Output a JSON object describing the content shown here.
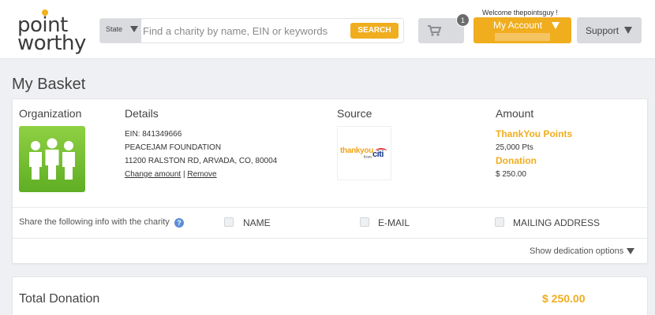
{
  "header": {
    "logo_line1": "point",
    "logo_line2": "worthy",
    "state_label": "State",
    "search_placeholder": "Find a charity by name, EIN or keywords",
    "search_button": "SEARCH",
    "cart_count": "1",
    "welcome_text": "Welcome thepointsguy !",
    "account_label": "My Account",
    "support_label": "Support"
  },
  "page_title": "My Basket",
  "basket": {
    "columns": {
      "organization": "Organization",
      "details": "Details",
      "source": "Source",
      "amount": "Amount"
    },
    "item": {
      "ein": "EIN: 841349666",
      "name": "PEACEJAM FOUNDATION",
      "address": "11200 RALSTON RD, ARVADA, CO, 80004",
      "change_amount": "Change amount",
      "separator": "|",
      "remove": "Remove",
      "source_logo_text": "thankyou",
      "source_logo_from": "from",
      "source_logo_brand": "citi",
      "points_label": "ThankYou Points",
      "points_value": "25,000 Pts",
      "donation_label": "Donation",
      "donation_value": "$ 250.00"
    },
    "share": {
      "label": "Share the following info with the charity",
      "info_icon_text": "?",
      "options": [
        "NAME",
        "E-MAIL",
        "MAILING ADDRESS"
      ]
    },
    "dedication_label": "Show dedication options"
  },
  "total": {
    "label": "Total Donation",
    "amount": "$ 250.00"
  },
  "colors": {
    "accent": "#f0ad1e",
    "org_icon_green": "#6cbb2c",
    "page_bg": "#eef0f3"
  }
}
